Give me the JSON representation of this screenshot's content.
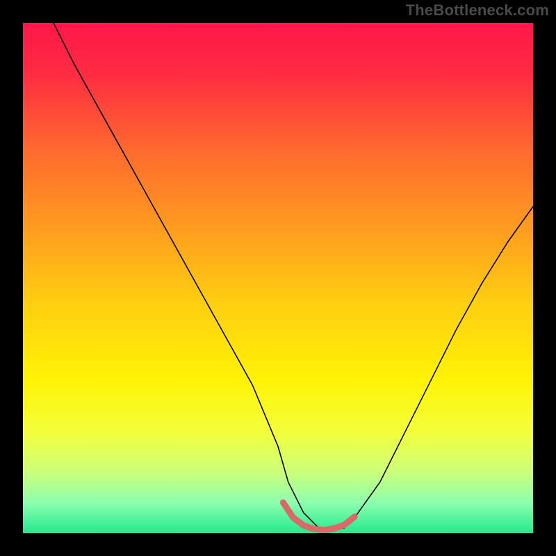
{
  "watermark": "TheBottleneck.com",
  "colors": {
    "frame": "#000000",
    "gradient_stops": [
      {
        "offset": 0.0,
        "color": "#ff1749"
      },
      {
        "offset": 0.1,
        "color": "#ff2c42"
      },
      {
        "offset": 0.25,
        "color": "#ff6a2e"
      },
      {
        "offset": 0.4,
        "color": "#ff9b1f"
      },
      {
        "offset": 0.55,
        "color": "#ffcf10"
      },
      {
        "offset": 0.7,
        "color": "#fff305"
      },
      {
        "offset": 0.8,
        "color": "#f4ff3a"
      },
      {
        "offset": 0.88,
        "color": "#ccff7a"
      },
      {
        "offset": 0.94,
        "color": "#8effae"
      },
      {
        "offset": 1.0,
        "color": "#24e98e"
      }
    ],
    "curve": "#000000",
    "bottom_highlight": "#d86a6a"
  },
  "chart_data": {
    "type": "line",
    "title": "",
    "xlabel": "",
    "ylabel": "",
    "xlim": [
      0,
      100
    ],
    "ylim": [
      0,
      100
    ],
    "series": [
      {
        "name": "bottleneck-curve",
        "x": [
          6,
          10,
          15,
          20,
          25,
          30,
          35,
          40,
          45,
          50,
          52,
          55,
          58,
          60,
          63,
          65,
          70,
          75,
          80,
          85,
          90,
          95,
          100
        ],
        "y": [
          100,
          92,
          83,
          74,
          65,
          56,
          47,
          38,
          29,
          17,
          10,
          4,
          1,
          0.5,
          1,
          3,
          10,
          20,
          30,
          40,
          49,
          57,
          64
        ]
      }
    ],
    "highlight_segment": {
      "name": "low-bottleneck-band",
      "x": [
        51,
        53,
        55,
        57,
        59,
        61,
        63,
        65
      ],
      "y": [
        6,
        3,
        1.5,
        0.8,
        0.6,
        0.9,
        1.6,
        3.2
      ]
    }
  }
}
